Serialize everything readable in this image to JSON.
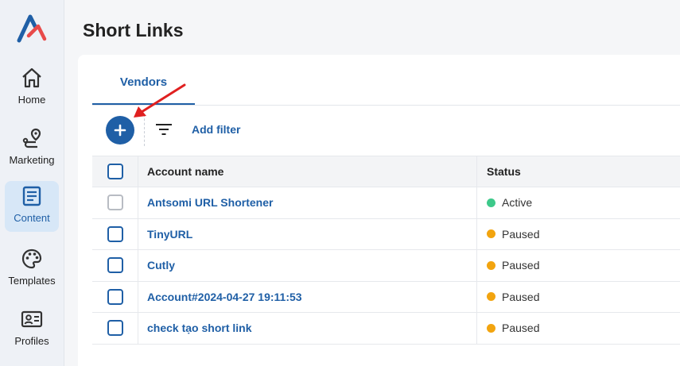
{
  "sidebar": {
    "items": [
      {
        "label": "Home",
        "icon": "home-icon",
        "active": false
      },
      {
        "label": "Marketing",
        "icon": "route-icon",
        "active": false
      },
      {
        "label": "Content",
        "icon": "document-icon",
        "active": true
      },
      {
        "label": "Templates",
        "icon": "palette-icon",
        "active": false
      },
      {
        "label": "Profiles",
        "icon": "id-card-icon",
        "active": false
      }
    ]
  },
  "header": {
    "title": "Short Links"
  },
  "tabs": [
    {
      "label": "Vendors",
      "active": true
    }
  ],
  "toolbar": {
    "add_icon": "plus-icon",
    "filter_icon": "filter-icon",
    "add_filter_label": "Add filter"
  },
  "table": {
    "columns": [
      "Account name",
      "Status"
    ],
    "rows": [
      {
        "name": "Antsomi URL Shortener",
        "status": "Active",
        "checkbox_disabled": true
      },
      {
        "name": "TinyURL",
        "status": "Paused",
        "checkbox_disabled": false
      },
      {
        "name": "Cutly",
        "status": "Paused",
        "checkbox_disabled": false
      },
      {
        "name": "Account#2024-04-27 19:11:53",
        "status": "Paused",
        "checkbox_disabled": false
      },
      {
        "name": "check tạo short link",
        "status": "Paused",
        "checkbox_disabled": false
      }
    ]
  },
  "colors": {
    "accent": "#1f5fa6",
    "active_status": "#3dc98a",
    "paused_status": "#f2a40f",
    "annotation_arrow": "#e02020"
  }
}
